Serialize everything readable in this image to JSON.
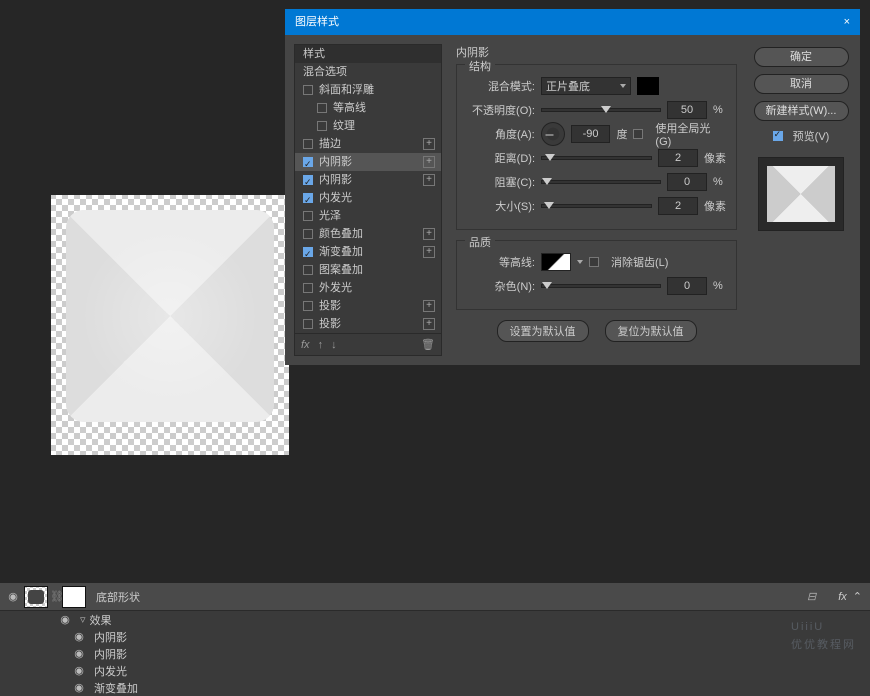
{
  "dialog": {
    "title": "图层样式",
    "panel_header": "样式",
    "blending_options": "混合选项",
    "styles": [
      {
        "label": "斜面和浮雕",
        "checked": false,
        "plus": false
      },
      {
        "label": "等高线",
        "checked": false,
        "plus": false,
        "indent": true
      },
      {
        "label": "纹理",
        "checked": false,
        "plus": false,
        "indent": true
      },
      {
        "label": "描边",
        "checked": false,
        "plus": true
      },
      {
        "label": "内阴影",
        "checked": true,
        "plus": true
      },
      {
        "label": "内阴影",
        "checked": true,
        "plus": true
      },
      {
        "label": "内发光",
        "checked": true,
        "plus": false
      },
      {
        "label": "光泽",
        "checked": false,
        "plus": false
      },
      {
        "label": "颜色叠加",
        "checked": false,
        "plus": true
      },
      {
        "label": "渐变叠加",
        "checked": true,
        "plus": true
      },
      {
        "label": "图案叠加",
        "checked": false,
        "plus": false
      },
      {
        "label": "外发光",
        "checked": false,
        "plus": false
      },
      {
        "label": "投影",
        "checked": false,
        "plus": true
      },
      {
        "label": "投影",
        "checked": false,
        "plus": true
      }
    ],
    "footer_fx": "fx",
    "section_title": "内阴影",
    "structure": {
      "title": "结构",
      "blend_mode_label": "混合模式:",
      "blend_mode_value": "正片叠底",
      "opacity_label": "不透明度(O):",
      "opacity_value": "50",
      "opacity_unit": "%",
      "angle_label": "角度(A):",
      "angle_value": "-90",
      "angle_unit": "度",
      "global_light": "使用全局光(G)",
      "distance_label": "距离(D):",
      "distance_value": "2",
      "distance_unit": "像素",
      "choke_label": "阻塞(C):",
      "choke_value": "0",
      "choke_unit": "%",
      "size_label": "大小(S):",
      "size_value": "2",
      "size_unit": "像素"
    },
    "quality": {
      "title": "品质",
      "contour_label": "等高线:",
      "antialias": "消除锯齿(L)",
      "noise_label": "杂色(N):",
      "noise_value": "0",
      "noise_unit": "%"
    },
    "make_default": "设置为默认值",
    "reset_default": "复位为默认值",
    "buttons": {
      "ok": "确定",
      "cancel": "取消",
      "new_style": "新建样式(W)...",
      "preview": "预览(V)"
    }
  },
  "layers": {
    "name": "底部形状",
    "fx": "fx",
    "effects_label": "效果",
    "effects": [
      "内阴影",
      "内阴影",
      "内发光",
      "渐变叠加"
    ]
  },
  "watermark": {
    "main": "UiiiU",
    "sub": "优优教程网"
  }
}
